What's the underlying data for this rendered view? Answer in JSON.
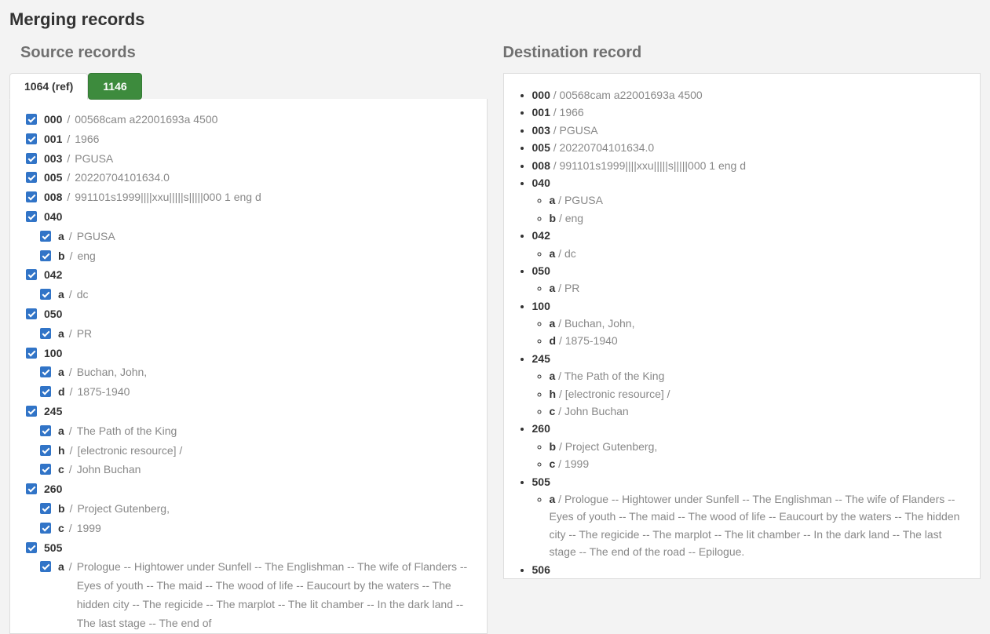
{
  "pageTitle": "Merging records",
  "source": {
    "heading": "Source records",
    "tabs": [
      {
        "label": "1064 (ref)",
        "active": true
      },
      {
        "label": "1146",
        "active": false
      }
    ],
    "fields": [
      {
        "tag": "000",
        "value": "00568cam a22001693a 4500"
      },
      {
        "tag": "001",
        "value": "1966"
      },
      {
        "tag": "003",
        "value": "PGUSA"
      },
      {
        "tag": "005",
        "value": "20220704101634.0"
      },
      {
        "tag": "008",
        "value": "991101s1999||||xxu|||||s|||||000 1 eng d"
      },
      {
        "tag": "040",
        "subs": [
          {
            "code": "a",
            "value": "PGUSA"
          },
          {
            "code": "b",
            "value": "eng"
          }
        ]
      },
      {
        "tag": "042",
        "subs": [
          {
            "code": "a",
            "value": "dc"
          }
        ]
      },
      {
        "tag": "050",
        "subs": [
          {
            "code": "a",
            "value": "PR"
          }
        ]
      },
      {
        "tag": "100",
        "subs": [
          {
            "code": "a",
            "value": "Buchan, John,"
          },
          {
            "code": "d",
            "value": "1875-1940"
          }
        ]
      },
      {
        "tag": "245",
        "subs": [
          {
            "code": "a",
            "value": "The Path of the King"
          },
          {
            "code": "h",
            "value": "[electronic resource] /"
          },
          {
            "code": "c",
            "value": "John Buchan"
          }
        ]
      },
      {
        "tag": "260",
        "subs": [
          {
            "code": "b",
            "value": "Project Gutenberg,"
          },
          {
            "code": "c",
            "value": "1999"
          }
        ]
      },
      {
        "tag": "505",
        "subs": [
          {
            "code": "a",
            "value": "Prologue -- Hightower under Sunfell -- The Englishman -- The wife of Flanders -- Eyes of youth -- The maid -- The wood of life -- Eaucourt by the waters -- The hidden city -- The regicide -- The marplot -- The lit chamber -- In the dark land -- The last stage -- The end of"
          }
        ]
      }
    ]
  },
  "destination": {
    "heading": "Destination record",
    "fields": [
      {
        "tag": "000",
        "value": "00568cam a22001693a 4500"
      },
      {
        "tag": "001",
        "value": "1966"
      },
      {
        "tag": "003",
        "value": "PGUSA"
      },
      {
        "tag": "005",
        "value": "20220704101634.0"
      },
      {
        "tag": "008",
        "value": "991101s1999||||xxu|||||s|||||000 1 eng d"
      },
      {
        "tag": "040",
        "subs": [
          {
            "code": "a",
            "value": "PGUSA"
          },
          {
            "code": "b",
            "value": "eng"
          }
        ]
      },
      {
        "tag": "042",
        "subs": [
          {
            "code": "a",
            "value": "dc"
          }
        ]
      },
      {
        "tag": "050",
        "subs": [
          {
            "code": "a",
            "value": "PR"
          }
        ]
      },
      {
        "tag": "100",
        "subs": [
          {
            "code": "a",
            "value": "Buchan, John,"
          },
          {
            "code": "d",
            "value": "1875-1940"
          }
        ]
      },
      {
        "tag": "245",
        "subs": [
          {
            "code": "a",
            "value": "The Path of the King"
          },
          {
            "code": "h",
            "value": "[electronic resource] /"
          },
          {
            "code": "c",
            "value": "John Buchan"
          }
        ]
      },
      {
        "tag": "260",
        "subs": [
          {
            "code": "b",
            "value": "Project Gutenberg,"
          },
          {
            "code": "c",
            "value": "1999"
          }
        ]
      },
      {
        "tag": "505",
        "subs": [
          {
            "code": "a",
            "value": "Prologue -- Hightower under Sunfell -- The Englishman -- The wife of Flanders -- Eyes of youth -- The maid -- The wood of life -- Eaucourt by the waters -- The hidden city -- The regicide -- The marplot -- The lit chamber -- In the dark land -- The last stage -- The end of the road -- Epilogue."
          }
        ]
      },
      {
        "tag": "506"
      }
    ]
  }
}
